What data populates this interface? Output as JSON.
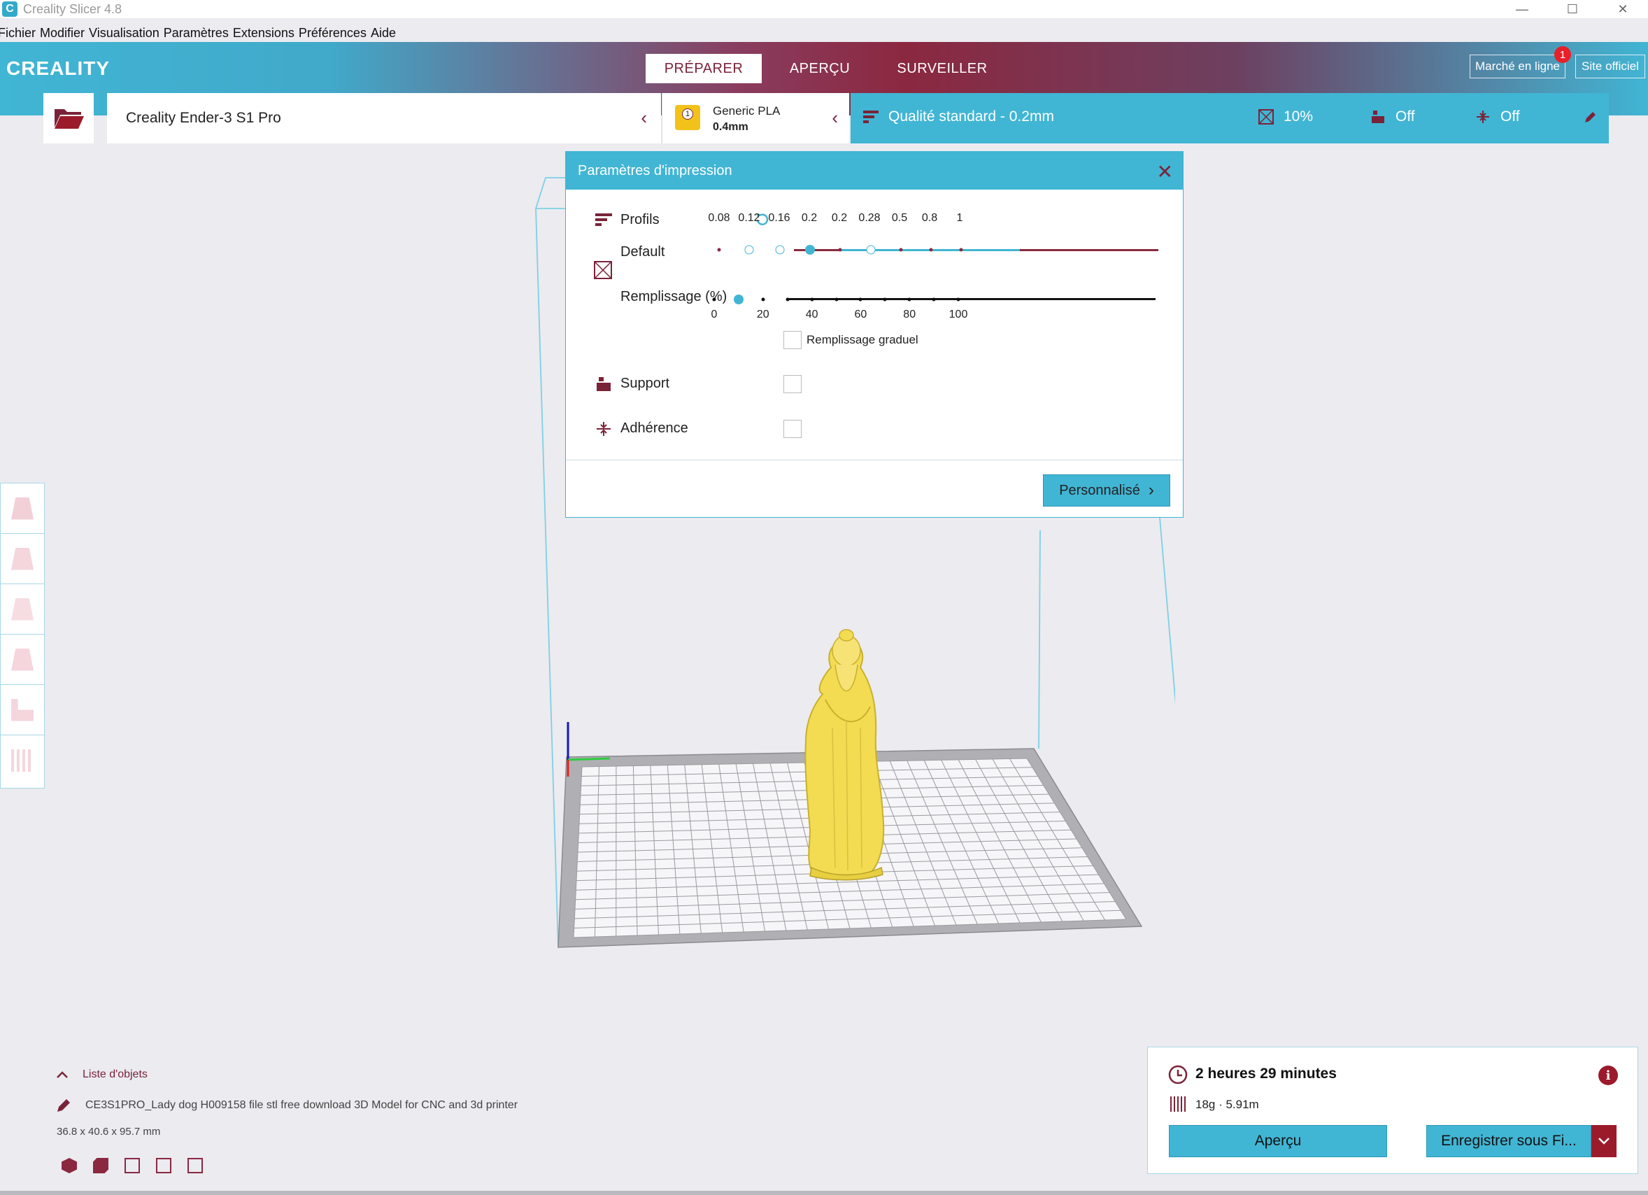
{
  "window": {
    "title": "Creality Slicer 4.8",
    "app_icon_letter": "C",
    "minimize": "—",
    "maximize": "☐",
    "close": "✕"
  },
  "menu": {
    "items": [
      "Fichier",
      "Modifier",
      "Visualisation",
      "Paramètres",
      "Extensions",
      "Préférences",
      "Aide"
    ]
  },
  "header": {
    "logo": "CREALITY",
    "stages": [
      "PRÉPARER",
      "APERÇU",
      "SURVEILLER"
    ],
    "active_stage": "PRÉPARER",
    "marketplace_label": "Marché en ligne",
    "marketplace_notifications": "1",
    "official_site_label": "Site officiel"
  },
  "printer": {
    "name": "Creality Ender-3 S1 Pro"
  },
  "material": {
    "badge": "1",
    "name": "Generic PLA",
    "nozzle": "0.4mm"
  },
  "quality": {
    "label": "Qualité standard - 0.2mm",
    "infill": "10%",
    "support": "Off",
    "adhesion": "Off"
  },
  "dialog": {
    "title": "Paramètres d'impression",
    "profiles_label": "Profils",
    "profile_default": "Default",
    "profile_ticks": [
      "0.08",
      "0.12",
      "0.16",
      "0.2",
      "0.2",
      "0.28",
      "0.5",
      "0.8",
      "1"
    ],
    "profile_selected_index": 3,
    "infill_label": "Remplissage (%)",
    "infill_ticks": [
      "0",
      "20",
      "40",
      "60",
      "80",
      "100"
    ],
    "infill_value": 10,
    "gradual_infill_label": "Remplissage graduel",
    "support_label": "Support",
    "adhesion_label": "Adhérence",
    "custom_button": "Personnalisé"
  },
  "objects": {
    "toggle_label": "Liste d'objets",
    "object_name": "CE3S1PRO_Lady dog H009158 file stl free download 3D Model for CNC and 3d printer",
    "dimensions": "36.8 x 40.6 x 95.7 mm"
  },
  "print_info": {
    "time": "2 heures 29 minutes",
    "material_usage": "18g · 5.91m",
    "preview_button": "Aperçu",
    "save_button": "Enregistrer sous Fi..."
  },
  "colors": {
    "accent": "#41b5d4",
    "brand_dark": "#7a2338",
    "model": "#f0d84a"
  }
}
